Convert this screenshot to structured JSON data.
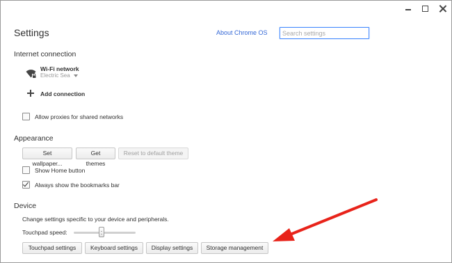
{
  "header": {
    "title": "Settings",
    "about_link": "About Chrome OS",
    "search_placeholder": "Search settings"
  },
  "internet": {
    "title": "Internet connection",
    "network_label": "Wi-Fi network",
    "network_name": "Electric Sea",
    "add_connection": "Add connection",
    "allow_proxies": "Allow proxies for shared networks",
    "allow_proxies_checked": false
  },
  "appearance": {
    "title": "Appearance",
    "set_wallpaper": "Set wallpaper...",
    "get_themes": "Get themes",
    "reset_theme": "Reset to default theme",
    "show_home": "Show Home button",
    "show_home_checked": false,
    "bookmarks_bar": "Always show the bookmarks bar",
    "bookmarks_bar_checked": true
  },
  "device": {
    "title": "Device",
    "description": "Change settings specific to your device and peripherals.",
    "touchpad_speed_label": "Touchpad speed:",
    "touchpad_speed_value": 0.45,
    "buttons": {
      "touchpad": "Touchpad settings",
      "keyboard": "Keyboard settings",
      "display": "Display settings",
      "storage": "Storage management"
    }
  },
  "annotation": {
    "arrow_color": "#e8231a"
  },
  "icons": {
    "minimize": "minimize-icon",
    "maximize": "maximize-icon",
    "close": "close-icon",
    "wifi": "wifi-icon",
    "add": "plus-icon"
  }
}
